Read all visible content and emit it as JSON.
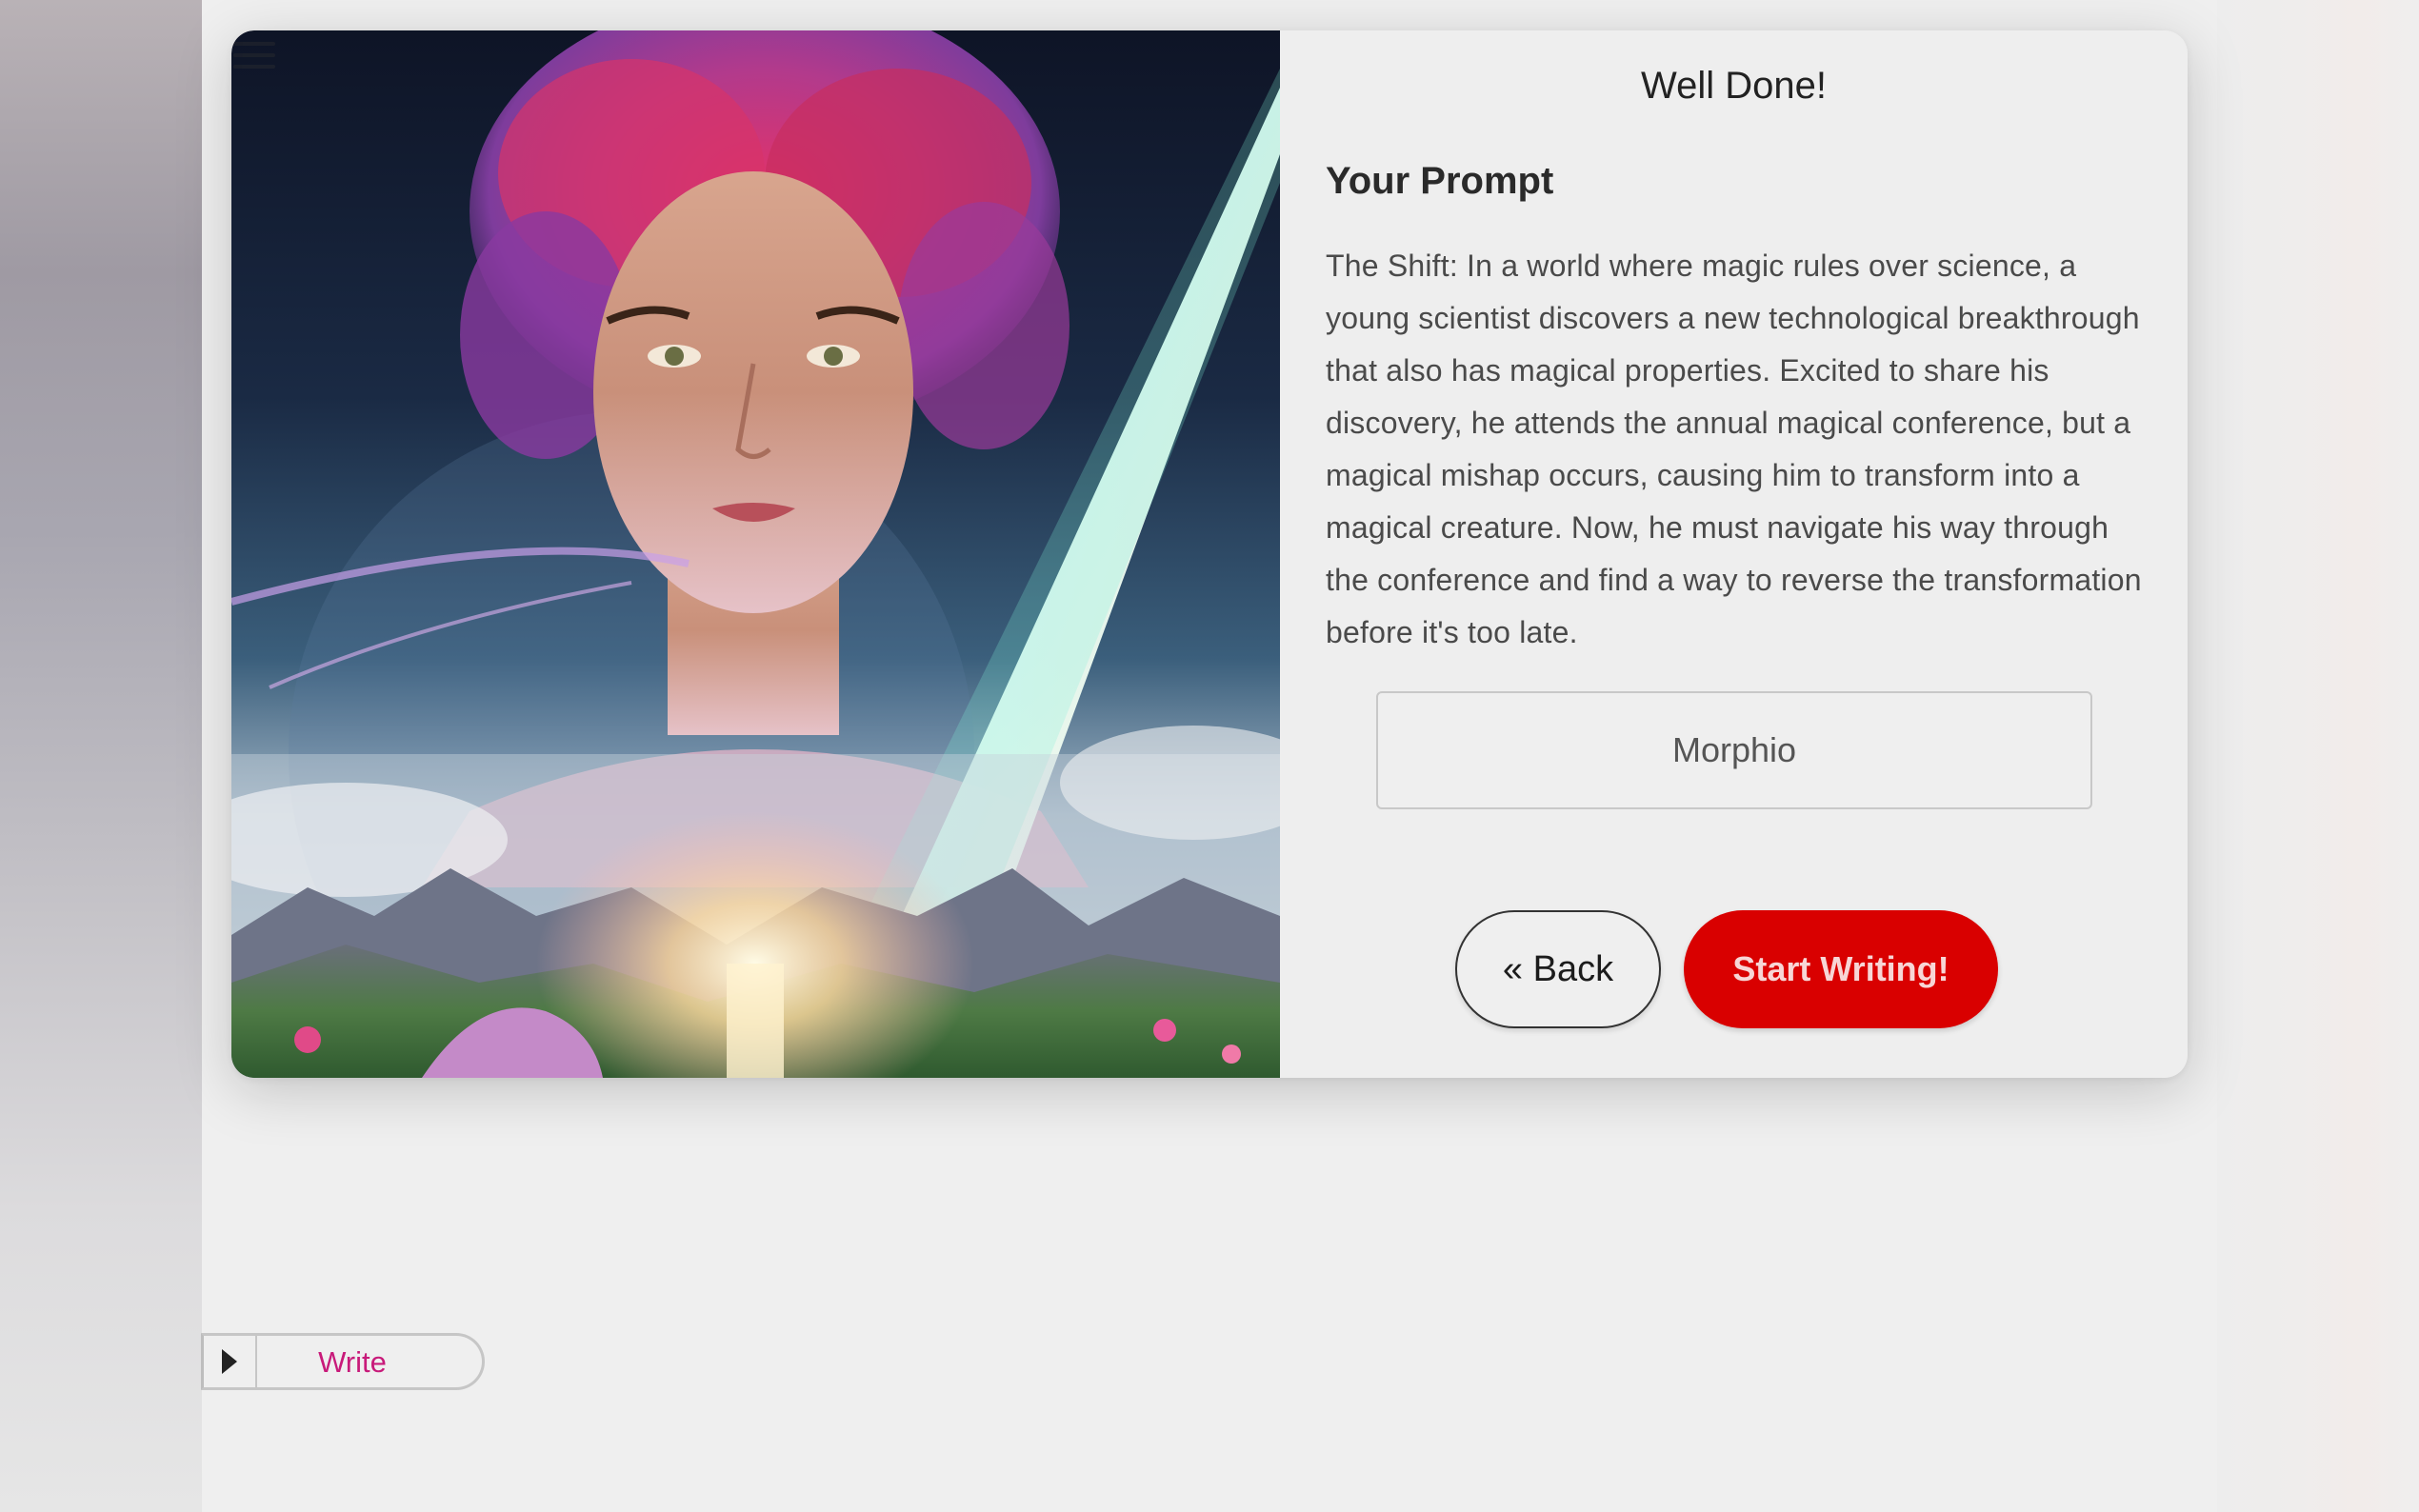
{
  "modal": {
    "title": "Well Done!",
    "prompt_heading": "Your Prompt",
    "prompt_text": "The Shift: In a world where magic rules over science, a young scientist discovers a new technological breakthrough that also has magical properties. Excited to share his discovery, he attends the annual magical conference, but a magical mishap occurs, causing him to transform into a magical creature. Now, he must navigate his way through the conference and find a way to reverse the transformation before it's too late.",
    "name_input_value": "Morphio",
    "back_label": "« Back",
    "start_label": "Start Writing!"
  },
  "sidebar_tab": {
    "label": "Write"
  },
  "colors": {
    "accent_red": "#d90000",
    "write_label": "#c81a7a"
  },
  "icons": {
    "menu": "hamburger-menu-icon",
    "toggle": "play-triangle-icon"
  }
}
